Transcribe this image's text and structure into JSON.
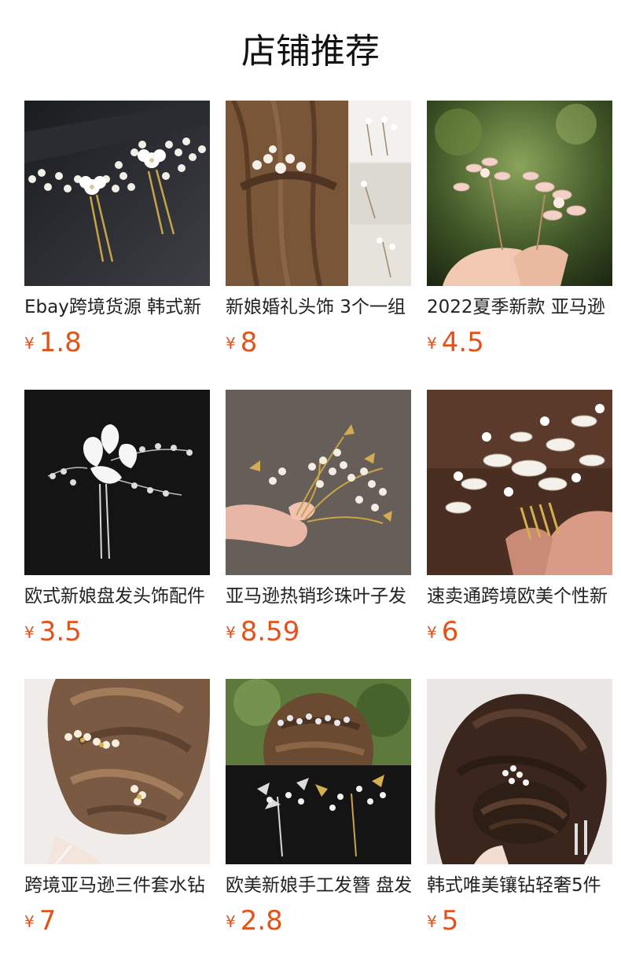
{
  "page": {
    "title": "店铺推荐"
  },
  "currency_symbol": "¥",
  "accent_color": "#e4521b",
  "products": [
    {
      "name": "Ebay跨境货源 韩式新",
      "price": "1.8",
      "image": "pearl-flower-hairpins-dark"
    },
    {
      "name": "新娘婚礼头饰 3个一组",
      "price": "8",
      "image": "bridal-hairpins-on-brunette-hair"
    },
    {
      "name": "2022夏季新款 亚马逊",
      "price": "4.5",
      "image": "pink-crystal-flower-pins-in-hand"
    },
    {
      "name": "欧式新娘盘发头饰配件",
      "price": "3.5",
      "image": "white-flower-crystal-hairpin"
    },
    {
      "name": "亚马逊热销珍珠叶子发",
      "price": "8.59",
      "image": "gold-leaf-pearl-hairpins-in-hand"
    },
    {
      "name": "速卖通跨境欧美个性新",
      "price": "6",
      "image": "rhinestone-hair-comb-in-hand"
    },
    {
      "name": "跨境亚马逊三件套水钻",
      "price": "7",
      "image": "pearl-pins-in-bridal-updo"
    },
    {
      "name": "欧美新娘手工发簪 盘发",
      "price": "2.8",
      "image": "crystal-hair-comb-updo-and-pins"
    },
    {
      "name": "韩式唯美镶钻轻奢5件",
      "price": "5",
      "image": "crystal-pin-in-dark-chignon"
    }
  ]
}
